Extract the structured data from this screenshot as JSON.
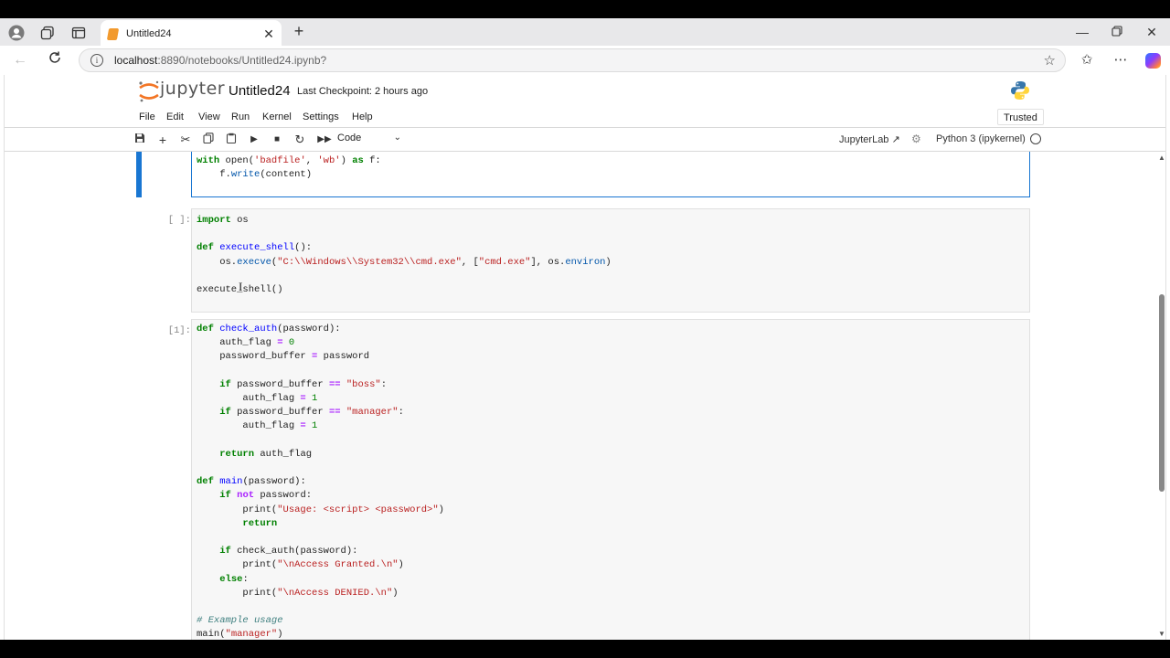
{
  "browser": {
    "tab_title": "Untitled24",
    "url_host": "localhost",
    "url_path": ":8890/notebooks/Untitled24.ipynb?"
  },
  "jupyter": {
    "logo_text": "jupyter",
    "notebook_title": "Untitled24",
    "checkpoint": "Last Checkpoint: 2 hours ago",
    "trusted": "Trusted",
    "menu": [
      "File",
      "Edit",
      "View",
      "Run",
      "Kernel",
      "Settings",
      "Help"
    ],
    "cell_type": "Code",
    "jupyterlab_link": "JupyterLab",
    "kernel_name": "Python 3 (ipykernel)"
  },
  "cells": [
    {
      "prompt": "",
      "lines": [
        "with open('badfile', 'wb') as f:",
        "    f.write(content)",
        ""
      ]
    },
    {
      "prompt": "[ ]:",
      "lines": [
        "import os",
        "",
        "def execute_shell():",
        "    os.execve(\"C:\\\\Windows\\\\System32\\\\cmd.exe\", [\"cmd.exe\"], os.environ)",
        "",
        "execute_shell()",
        ""
      ]
    },
    {
      "prompt": "[1]:",
      "lines": [
        "def check_auth(password):",
        "    auth_flag = 0",
        "    password_buffer = password",
        "",
        "    if password_buffer == \"boss\":",
        "        auth_flag = 1",
        "    if password_buffer == \"manager\":",
        "        auth_flag = 1",
        "",
        "    return auth_flag",
        "",
        "def main(password):",
        "    if not password:",
        "        print(\"Usage: <script> <password>\")",
        "        return",
        "",
        "    if check_auth(password):",
        "        print(\"\\nAccess Granted.\\n\")",
        "    else:",
        "        print(\"\\nAccess DENIED.\\n\")",
        "",
        "# Example usage",
        "main(\"manager\")"
      ]
    }
  ],
  "colors": {
    "accent": "#1976d2",
    "keyword": "#008000",
    "string": "#ba2121",
    "function": "#0000ff",
    "operator": "#aa22ff",
    "comment": "#408080"
  }
}
